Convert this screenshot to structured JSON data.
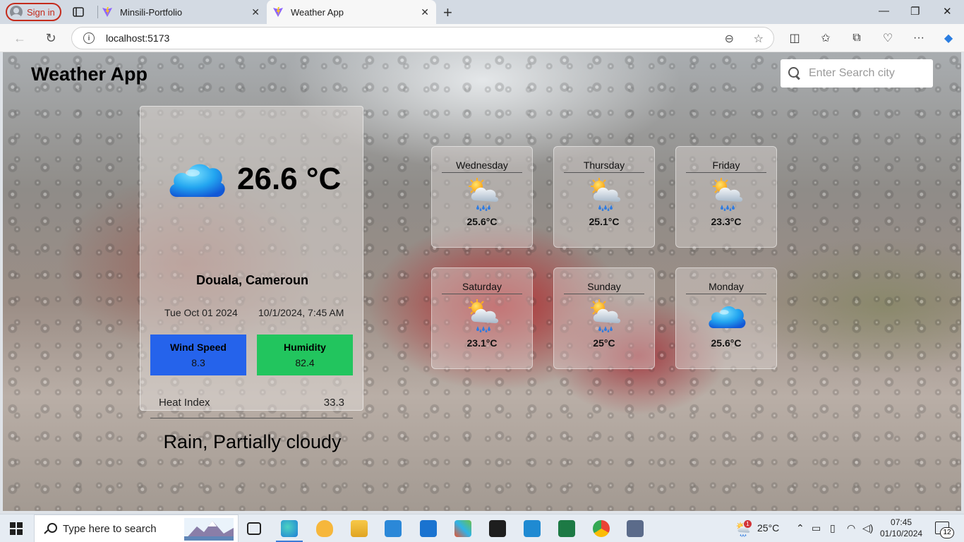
{
  "browser": {
    "signin_label": "Sign in",
    "tabs": [
      {
        "title": "Minsili-Portfolio"
      },
      {
        "title": "Weather App"
      }
    ],
    "url": "localhost:5173"
  },
  "app": {
    "title": "Weather App",
    "search_placeholder": "Enter Search city"
  },
  "current": {
    "temperature": "26.6 °C",
    "location": "Douala, Cameroun",
    "date": "Tue Oct 01 2024",
    "datetime": "10/1/2024, 7:45 AM",
    "wind_label": "Wind Speed",
    "wind_value": "8.3",
    "humidity_label": "Humidity",
    "humidity_value": "82.4",
    "heat_index_label": "Heat Index",
    "heat_index_value": "33.3",
    "condition": "Rain, Partially cloudy",
    "icon": "cloud-icon",
    "colors": {
      "wind": "#2563eb",
      "humidity": "#22c55e"
    }
  },
  "forecast": [
    {
      "day": "Wednesday",
      "temp": "25.6°C",
      "icon": "sun-rain-cloud-icon"
    },
    {
      "day": "Thursday",
      "temp": "25.1°C",
      "icon": "sun-rain-cloud-icon"
    },
    {
      "day": "Friday",
      "temp": "23.3°C",
      "icon": "sun-rain-cloud-icon"
    },
    {
      "day": "Saturday",
      "temp": "23.1°C",
      "icon": "sun-rain-cloud-icon"
    },
    {
      "day": "Sunday",
      "temp": "25°C",
      "icon": "sun-rain-cloud-icon"
    },
    {
      "day": "Monday",
      "temp": "25.6°C",
      "icon": "cloud-icon"
    }
  ],
  "taskbar": {
    "search_placeholder": "Type here to search",
    "weather_temp": "25°C",
    "weather_badge": "1",
    "time": "07:45",
    "date": "01/10/2024",
    "notification_count": "12"
  }
}
